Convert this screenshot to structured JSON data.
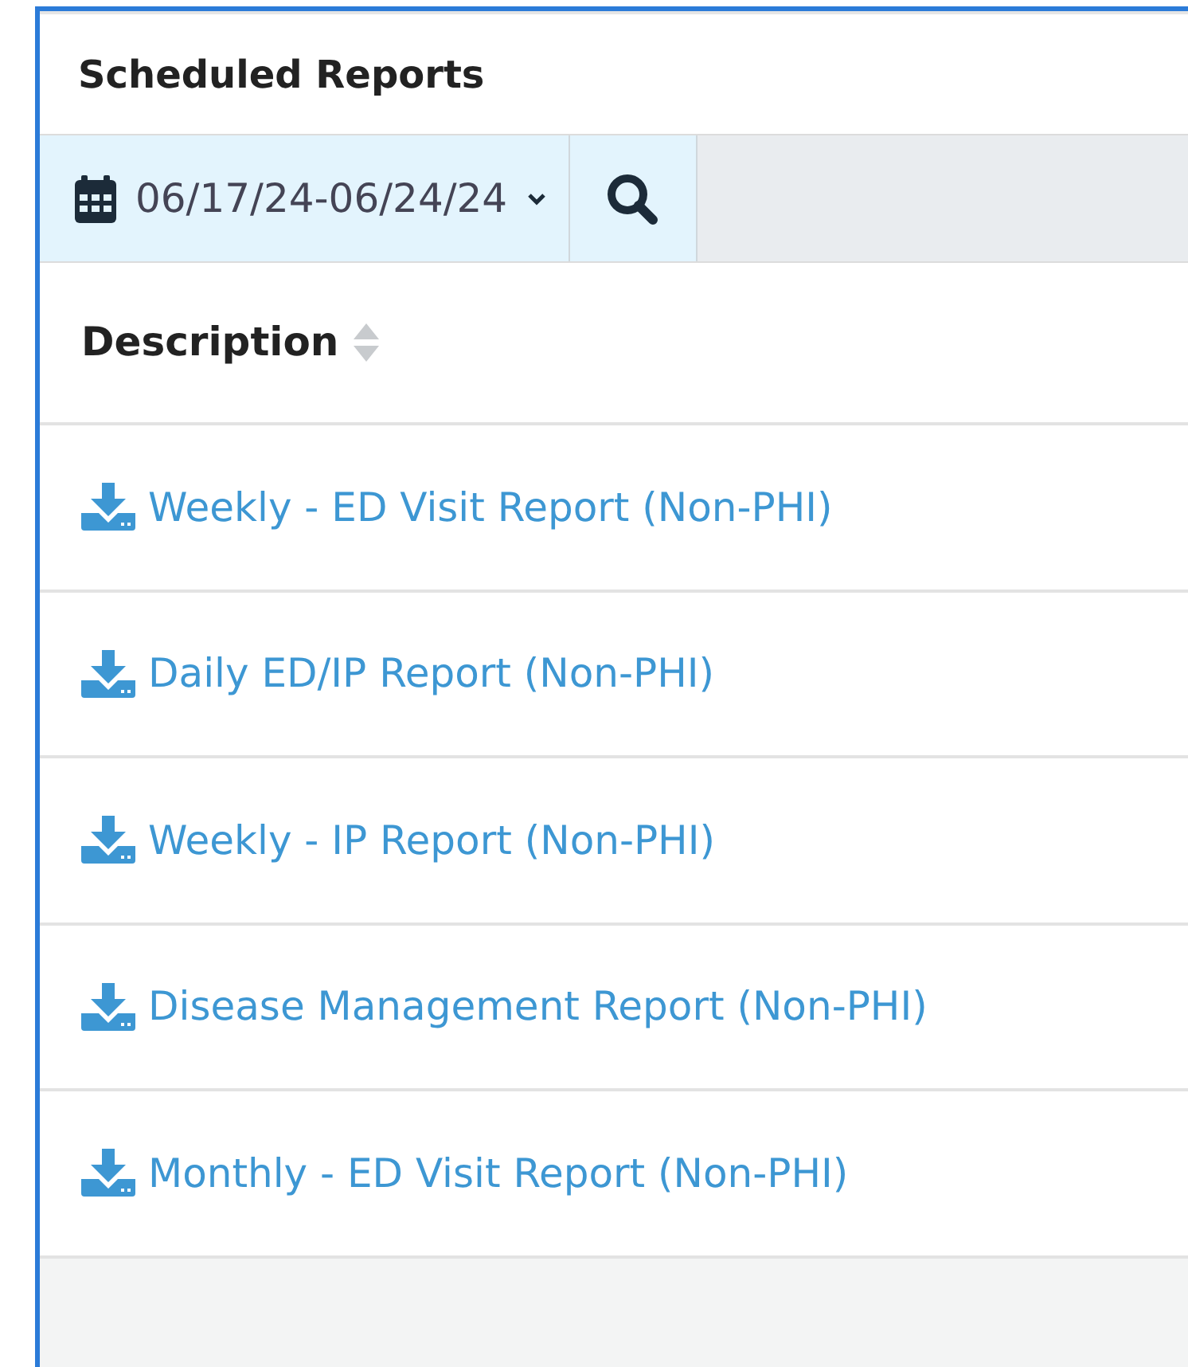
{
  "panel": {
    "title": "Scheduled Reports"
  },
  "toolbar": {
    "date_range": "06/17/24-06/24/24"
  },
  "table": {
    "columns": [
      {
        "label": "Description"
      }
    ],
    "rows": [
      {
        "description": "Weekly - ED Visit Report (Non-PHI)"
      },
      {
        "description": "Daily ED/IP Report (Non-PHI)"
      },
      {
        "description": "Weekly - IP Report (Non-PHI)"
      },
      {
        "description": "Disease Management Report (Non-PHI)"
      },
      {
        "description": "Monthly - ED Visit Report (Non-PHI)"
      }
    ]
  }
}
